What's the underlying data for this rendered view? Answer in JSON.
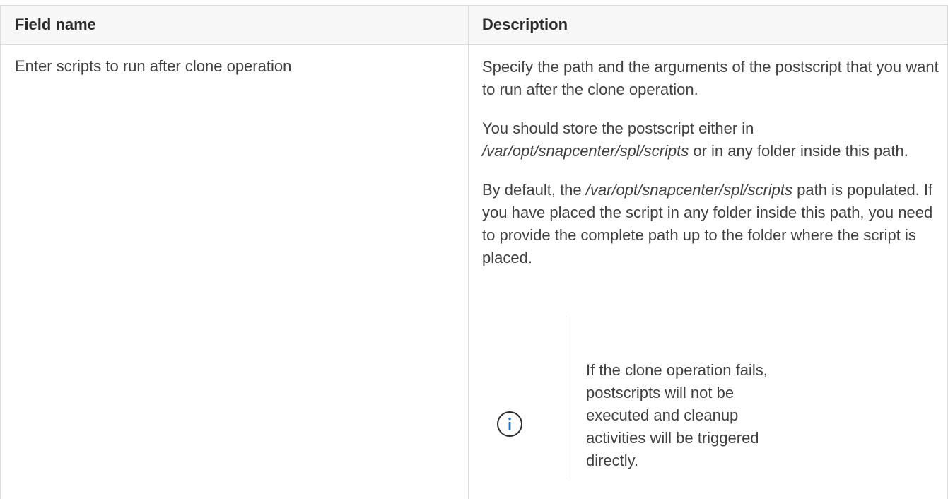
{
  "table": {
    "headers": {
      "field_name": "Field name",
      "description": "Description"
    },
    "row": {
      "field": "Enter scripts to run after clone operation",
      "desc_p1": "Specify the path and the arguments of the postscript that you want to run after the clone operation.",
      "desc_p2_before": "You should store the postscript either in ",
      "desc_p2_path": "/var/opt/snapcenter/spl/scripts",
      "desc_p2_after": " or in any folder inside this path.",
      "desc_p3_before": "By default, the ",
      "desc_p3_path": "/var/opt/snapcenter/spl/scripts",
      "desc_p3_after": " path is populated. If you have placed the script in any folder inside this path, you need to provide the complete path up to the folder where the script is placed.",
      "note": {
        "icon": "info-icon",
        "text": "If the clone operation fails, postscripts will not be executed and cleanup activities will be triggered directly."
      }
    }
  },
  "colors": {
    "text": "#404040",
    "header_bg": "#f7f7f7",
    "border": "#dcdcdc",
    "info_icon": "#1e73be"
  }
}
